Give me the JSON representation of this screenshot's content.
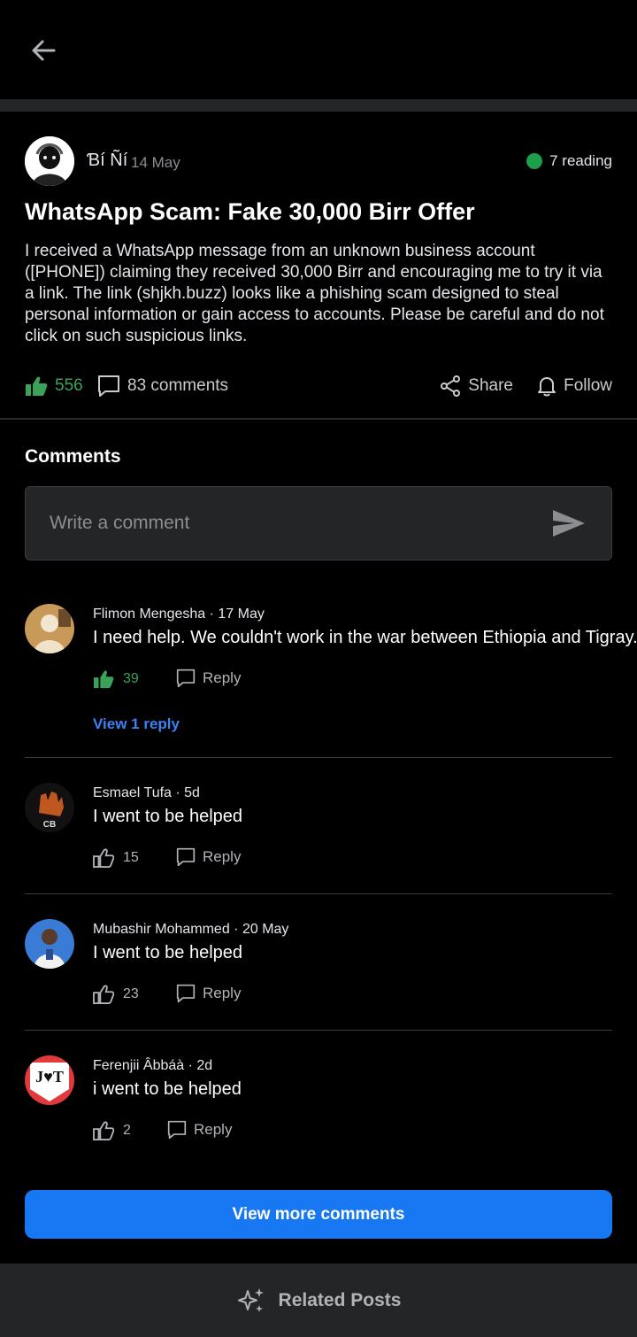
{
  "header": {
    "back_icon": "arrow-left-icon"
  },
  "post": {
    "author": "Ɓí Ñí",
    "date": "14 May",
    "reading": "7 reading",
    "title": "WhatsApp Scam: Fake 30,000 Birr Offer",
    "body": "I received a WhatsApp message from an unknown business account ([PHONE]) claiming they received 30,000 Birr and encouraging me to try it via a link. The link (shjkh.buzz) looks like a phishing scam designed to steal personal information or gain access to accounts. Please be careful and do not click on such suspicious links.",
    "likes": "556",
    "comments": "83 comments",
    "share_label": "Share",
    "follow_label": "Follow"
  },
  "comments_section": {
    "title": "Comments",
    "input_placeholder": "Write a comment"
  },
  "comments": [
    {
      "author": "Flimon Mengesha",
      "time": "17 May",
      "text": "I need help. We couldn't work in the war between Ethiopia and Tigray.",
      "likes": "39",
      "liked": true,
      "reply_label": "Reply",
      "view_replies": "View 1 reply"
    },
    {
      "author": "Esmael Tufa",
      "time": "5d",
      "text": "I went to be helped",
      "likes": "15",
      "liked": false,
      "reply_label": "Reply"
    },
    {
      "author": "Mubashir Mohammed",
      "time": "20 May",
      "text": "I went to be helped",
      "likes": "23",
      "liked": false,
      "reply_label": "Reply"
    },
    {
      "author": "Ferenjii Âbbáà",
      "time": "2d",
      "text": "i went to be helped",
      "likes": "2",
      "liked": false,
      "reply_label": "Reply",
      "avatar_text": "J♥T"
    }
  ],
  "view_more_label": "View more comments",
  "related_label": "Related Posts",
  "colors": {
    "accent": "#1877f2",
    "liked": "#3aa35a",
    "online": "#1e9e4a",
    "link": "#3b82f6"
  }
}
